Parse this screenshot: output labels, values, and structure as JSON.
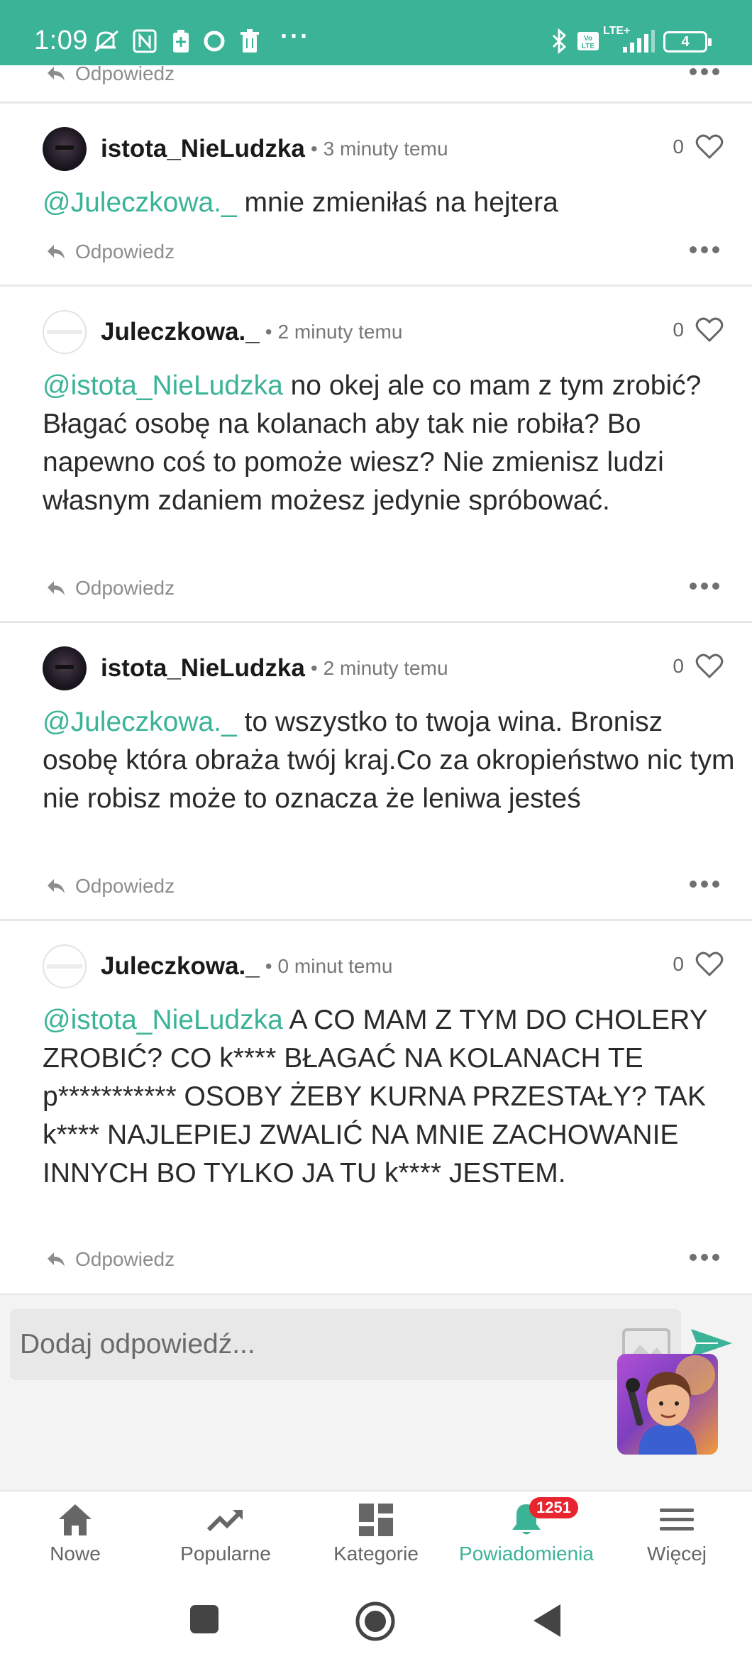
{
  "status_bar": {
    "time": "1:09",
    "lte_label": "LTE+",
    "battery": "4"
  },
  "partial_comment": {
    "reply_label": "Odpowiedz"
  },
  "comments": [
    {
      "username": "istota_NieLudzka",
      "time": "3 minuty temu",
      "likes": "0",
      "mention": "@Juleczkowa._",
      "text": " mnie zmieniłaś na hejtera",
      "reply_label": "Odpowiedz"
    },
    {
      "username": "Juleczkowa._",
      "time": "2 minuty temu",
      "likes": "0",
      "mention": "@istota_NieLudzka",
      "text": " no okej ale co mam z tym zrobić? Błagać osobę na kolanach aby tak nie robiła? Bo napewno coś to pomoże wiesz? Nie zmienisz ludzi własnym zdaniem możesz jedynie spróbować.",
      "reply_label": "Odpowiedz"
    },
    {
      "username": "istota_NieLudzka",
      "time": "2 minuty temu",
      "likes": "0",
      "mention": "@Juleczkowa._",
      "text": " to wszystko to twoja wina. Bronisz osobę która obraża twój kraj.Co za okropieństwo nic tym nie robisz może to oznacza że leniwa jesteś",
      "reply_label": "Odpowiedz"
    },
    {
      "username": "Juleczkowa._",
      "time": "0 minut temu",
      "likes": "0",
      "mention": "@istota_NieLudzka",
      "text": " A CO MAM Z TYM DO CHOLERY ZROBIĆ? CO k**** BŁAGAĆ NA KOLANACH TE p*********** OSOBY ŻEBY KURNA PRZESTAŁY? TAK k**** NAJLEPIEJ ZWALIĆ NA MNIE ZACHOWANIE INNYCH BO TYLKO JA TU k**** JESTEM.",
      "reply_label": "Odpowiedz"
    }
  ],
  "reply_box": {
    "placeholder": "Dodaj odpowiedź..."
  },
  "bottom_nav": [
    {
      "label": "Nowe",
      "icon": "home-icon"
    },
    {
      "label": "Popularne",
      "icon": "trending-icon"
    },
    {
      "label": "Kategorie",
      "icon": "grid-icon"
    },
    {
      "label": "Powiadomienia",
      "icon": "bell-icon",
      "badge": "1251",
      "active": true
    },
    {
      "label": "Więcej",
      "icon": "menu-icon"
    }
  ],
  "colors": {
    "accent": "#3bb397",
    "badge": "#e8242e"
  }
}
